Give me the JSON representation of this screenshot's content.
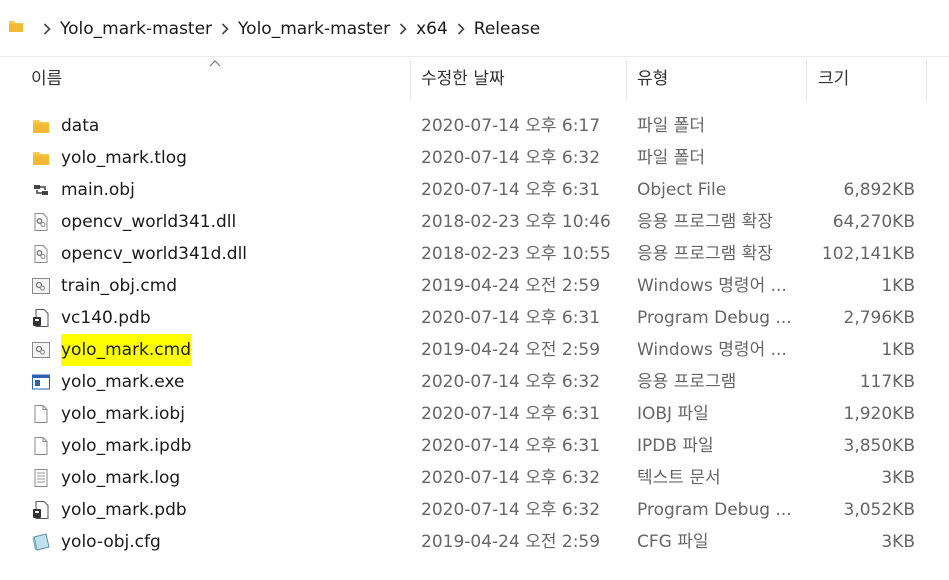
{
  "breadcrumb": [
    "Yolo_mark-master",
    "Yolo_mark-master",
    "x64",
    "Release"
  ],
  "header": {
    "name": "이름",
    "date": "수정한 날짜",
    "type": "유형",
    "size": "크기"
  },
  "files": [
    {
      "name": "data",
      "date": "2020-07-14 오후 6:17",
      "type": "파일 폴더",
      "size": "",
      "icon": "folder-icon"
    },
    {
      "name": "yolo_mark.tlog",
      "date": "2020-07-14 오후 6:32",
      "type": "파일 폴더",
      "size": "",
      "icon": "folder-icon"
    },
    {
      "name": "main.obj",
      "date": "2020-07-14 오후 6:31",
      "type": "Object File",
      "size": "6,892KB",
      "icon": "object-file-icon"
    },
    {
      "name": "opencv_world341.dll",
      "date": "2018-02-23 오후 10:46",
      "type": "응용 프로그램 확장",
      "size": "64,270KB",
      "icon": "dll-file-icon"
    },
    {
      "name": "opencv_world341d.dll",
      "date": "2018-02-23 오후 10:55",
      "type": "응용 프로그램 확장",
      "size": "102,141KB",
      "icon": "dll-file-icon"
    },
    {
      "name": "train_obj.cmd",
      "date": "2019-04-24 오전 2:59",
      "type": "Windows 명령어 ...",
      "size": "1KB",
      "icon": "cmd-file-icon"
    },
    {
      "name": "vc140.pdb",
      "date": "2020-07-14 오후 6:31",
      "type": "Program Debug ...",
      "size": "2,796KB",
      "icon": "pdb-file-icon"
    },
    {
      "name": "yolo_mark.cmd",
      "date": "2019-04-24 오전 2:59",
      "type": "Windows 명령어 ...",
      "size": "1KB",
      "icon": "cmd-file-icon",
      "highlight": true
    },
    {
      "name": "yolo_mark.exe",
      "date": "2020-07-14 오후 6:32",
      "type": "응용 프로그램",
      "size": "117KB",
      "icon": "exe-file-icon"
    },
    {
      "name": "yolo_mark.iobj",
      "date": "2020-07-14 오후 6:31",
      "type": "IOBJ 파일",
      "size": "1,920KB",
      "icon": "blank-file-icon"
    },
    {
      "name": "yolo_mark.ipdb",
      "date": "2020-07-14 오후 6:31",
      "type": "IPDB 파일",
      "size": "3,850KB",
      "icon": "blank-file-icon"
    },
    {
      "name": "yolo_mark.log",
      "date": "2020-07-14 오후 6:32",
      "type": "텍스트 문서",
      "size": "3KB",
      "icon": "text-file-icon"
    },
    {
      "name": "yolo_mark.pdb",
      "date": "2020-07-14 오후 6:32",
      "type": "Program Debug ...",
      "size": "3,052KB",
      "icon": "pdb-file-icon"
    },
    {
      "name": "yolo-obj.cfg",
      "date": "2019-04-24 오전 2:59",
      "type": "CFG 파일",
      "size": "3KB",
      "icon": "cfg-file-icon"
    }
  ],
  "colors": {
    "highlight": "#ffff00",
    "folder": "#f8c94a"
  }
}
